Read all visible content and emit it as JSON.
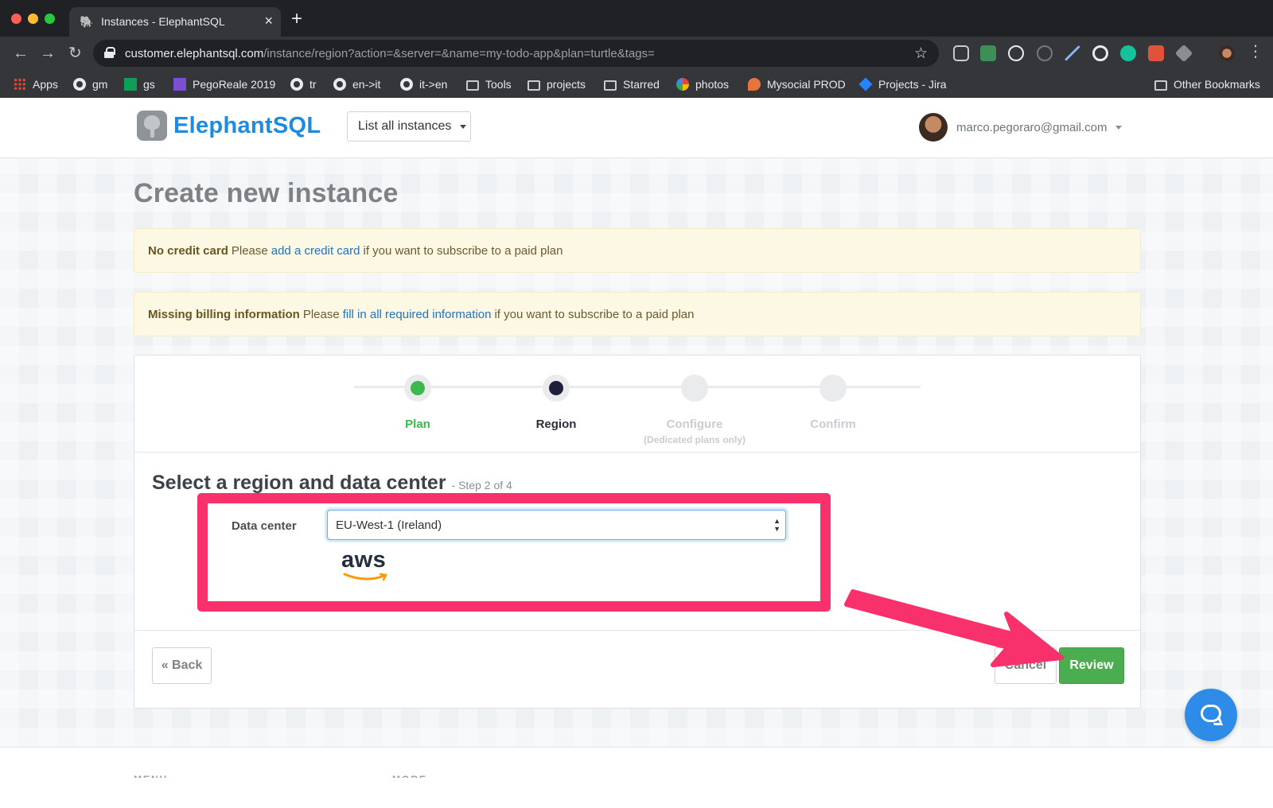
{
  "browser": {
    "tab_title": "Instances - ElephantSQL",
    "url_host": "customer.elephantsql.com",
    "url_path": "/instance/region?action=&server=&name=my-todo-app&plan=turtle&tags=",
    "bookmarks": [
      {
        "label": "Apps",
        "icon": "apps-grid-icon"
      },
      {
        "label": "gm",
        "icon": "globe-icon"
      },
      {
        "label": "gs",
        "icon": "sheets-icon"
      },
      {
        "label": "PegoReale 2019",
        "icon": "list-icon"
      },
      {
        "label": "tr",
        "icon": "globe-icon"
      },
      {
        "label": "en->it",
        "icon": "globe-icon"
      },
      {
        "label": "it->en",
        "icon": "globe-icon"
      },
      {
        "label": "Tools",
        "icon": "folder-icon"
      },
      {
        "label": "projects",
        "icon": "folder-icon"
      },
      {
        "label": "Starred",
        "icon": "folder-icon"
      },
      {
        "label": "photos",
        "icon": "photos-icon"
      },
      {
        "label": "Mysocial PROD",
        "icon": "flame-icon"
      },
      {
        "label": "Projects - Jira",
        "icon": "jira-icon"
      }
    ],
    "other_bookmarks": "Other Bookmarks"
  },
  "header": {
    "logo_text": "ElephantSQL",
    "list_instances": "List all instances",
    "user_email": "marco.pegoraro@gmail.com"
  },
  "page": {
    "title": "Create new instance",
    "alert_card": {
      "strong": "No credit card",
      "before": "Please",
      "link": "add a credit card",
      "after": "if you want to subscribe to a paid plan"
    },
    "alert_billing": {
      "strong": "Missing billing information",
      "before": "Please",
      "link": "fill in all required information",
      "after": "if you want to subscribe to a paid plan"
    }
  },
  "wizard": {
    "steps": [
      {
        "label": "Plan",
        "sub": "",
        "state": "done",
        "color": "#3cb84c"
      },
      {
        "label": "Region",
        "sub": "",
        "state": "current",
        "color": "#1e1f3b"
      },
      {
        "label": "Configure",
        "sub": "(Dedicated plans only)",
        "state": "todo",
        "color": "#c9ccd0"
      },
      {
        "label": "Confirm",
        "sub": "",
        "state": "todo",
        "color": "#c9ccd0"
      }
    ],
    "section_title": "Select a region and data center",
    "section_step": "- Step 2 of 4",
    "data_center_label": "Data center",
    "data_center_value": "EU-West-1 (Ireland)",
    "provider_logo": "aws",
    "back": "« Back",
    "cancel": "Cancel",
    "review": "Review"
  },
  "footer": {
    "col1": "MENU",
    "col2": "MORE"
  },
  "colors": {
    "accent_blue": "#1d8ce0",
    "review_green": "#4aad50",
    "annotation_pink": "#f8306b"
  }
}
